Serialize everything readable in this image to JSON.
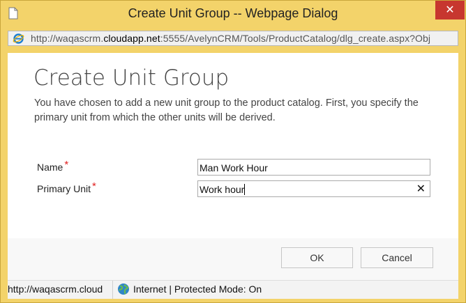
{
  "window": {
    "title": "Create Unit Group -- Webpage Dialog",
    "close_icon": "close-icon",
    "app_icon": "page-icon"
  },
  "address_bar": {
    "icon": "internet-explorer-icon",
    "url_prefix": "http://waqascrm.",
    "url_domain": "cloudapp.net",
    "url_rest": ":5555/AvelynCRM/Tools/ProductCatalog/dlg_create.aspx?Obj"
  },
  "dialog": {
    "heading": "Create Unit Group",
    "description": "You have chosen to add a new unit group to the product catalog. First, you specify the primary unit from which the other units will be derived."
  },
  "form": {
    "name_label": "Name",
    "name_value": "Man Work Hour",
    "primary_unit_label": "Primary Unit",
    "primary_unit_value": "Work hour",
    "required_marker": "*",
    "clear_symbol": "✕"
  },
  "buttons": {
    "ok": "OK",
    "cancel": "Cancel"
  },
  "status_bar": {
    "url": "http://waqascrm.cloud",
    "zone_icon": "globe-icon",
    "zone_text": "Internet | Protected Mode: On"
  },
  "colors": {
    "title_bar": "#f3d36a",
    "close_button": "#c7372f",
    "required": "#e02020"
  }
}
